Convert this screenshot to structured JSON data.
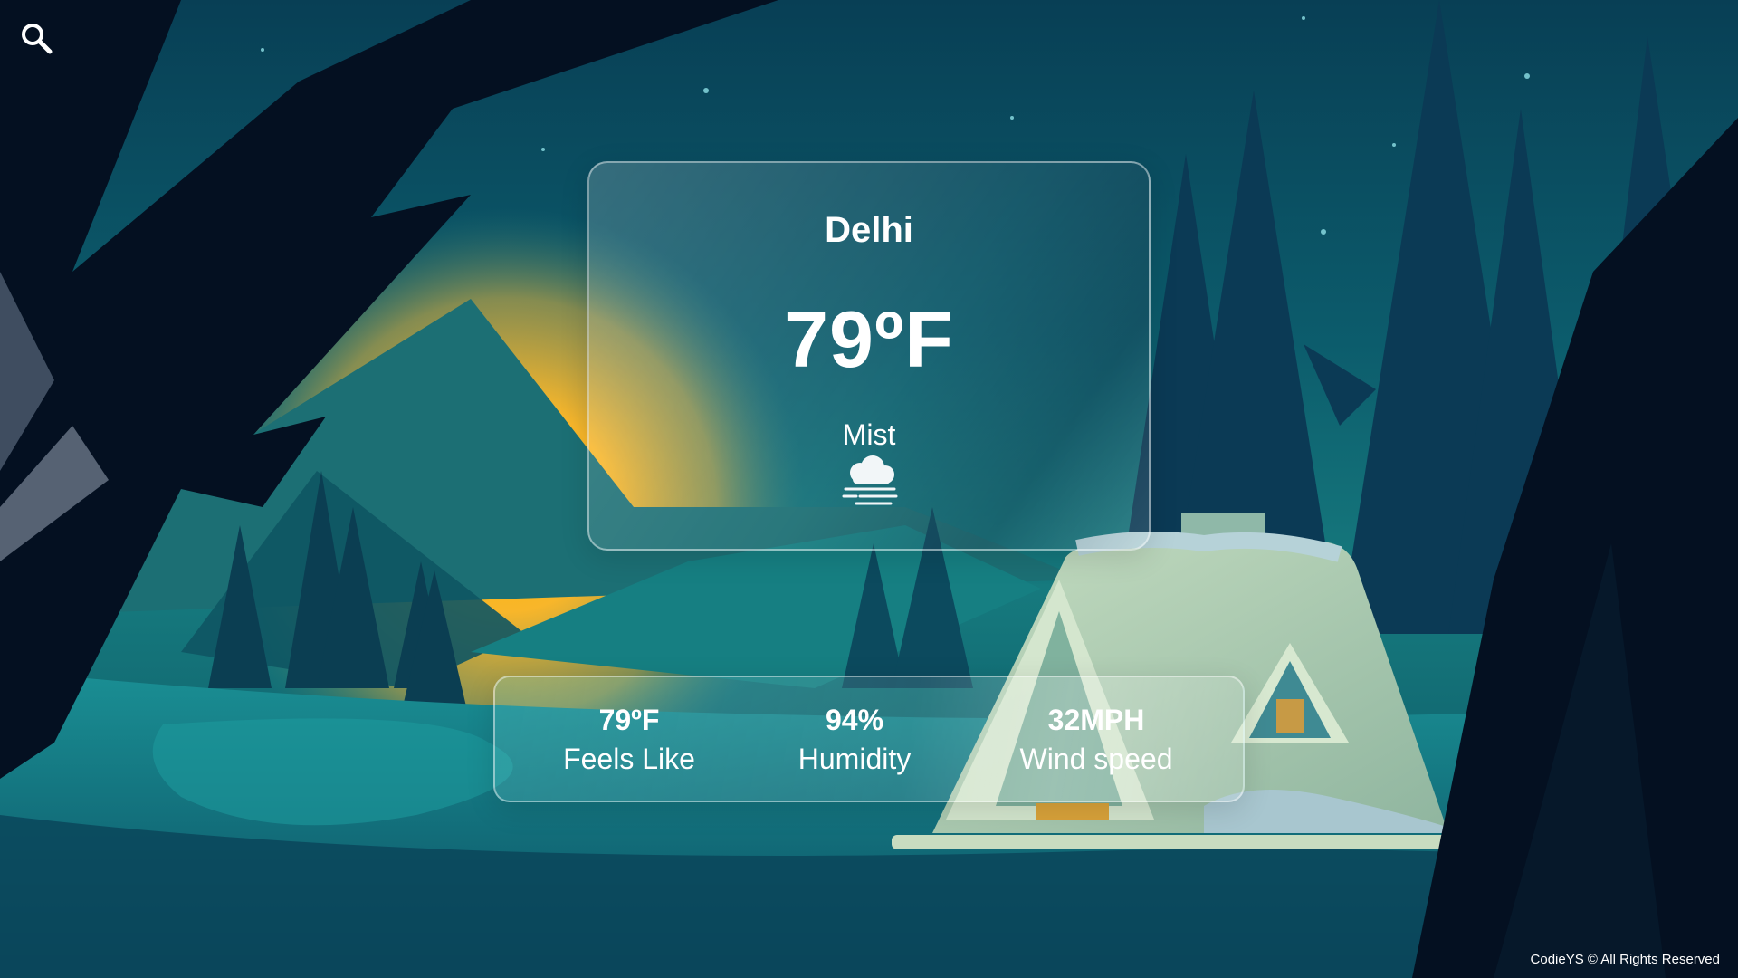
{
  "app": {
    "search_icon": "search-icon"
  },
  "weather": {
    "city": "Delhi",
    "temperature": "79ºF",
    "condition": "Mist",
    "condition_icon": "mist-icon"
  },
  "stats": {
    "feels_like": {
      "value": "79ºF",
      "label": "Feels Like"
    },
    "humidity": {
      "value": "94%",
      "label": "Humidity"
    },
    "wind": {
      "value": "32MPH",
      "label": "Wind speed"
    }
  },
  "footer": {
    "text": "CodieYS © All Rights Reserved"
  },
  "colors": {
    "sky_top": "#06465a",
    "sun": "#ffb300",
    "dark_silhouette": "#041021",
    "house": "#a9c9a8"
  }
}
